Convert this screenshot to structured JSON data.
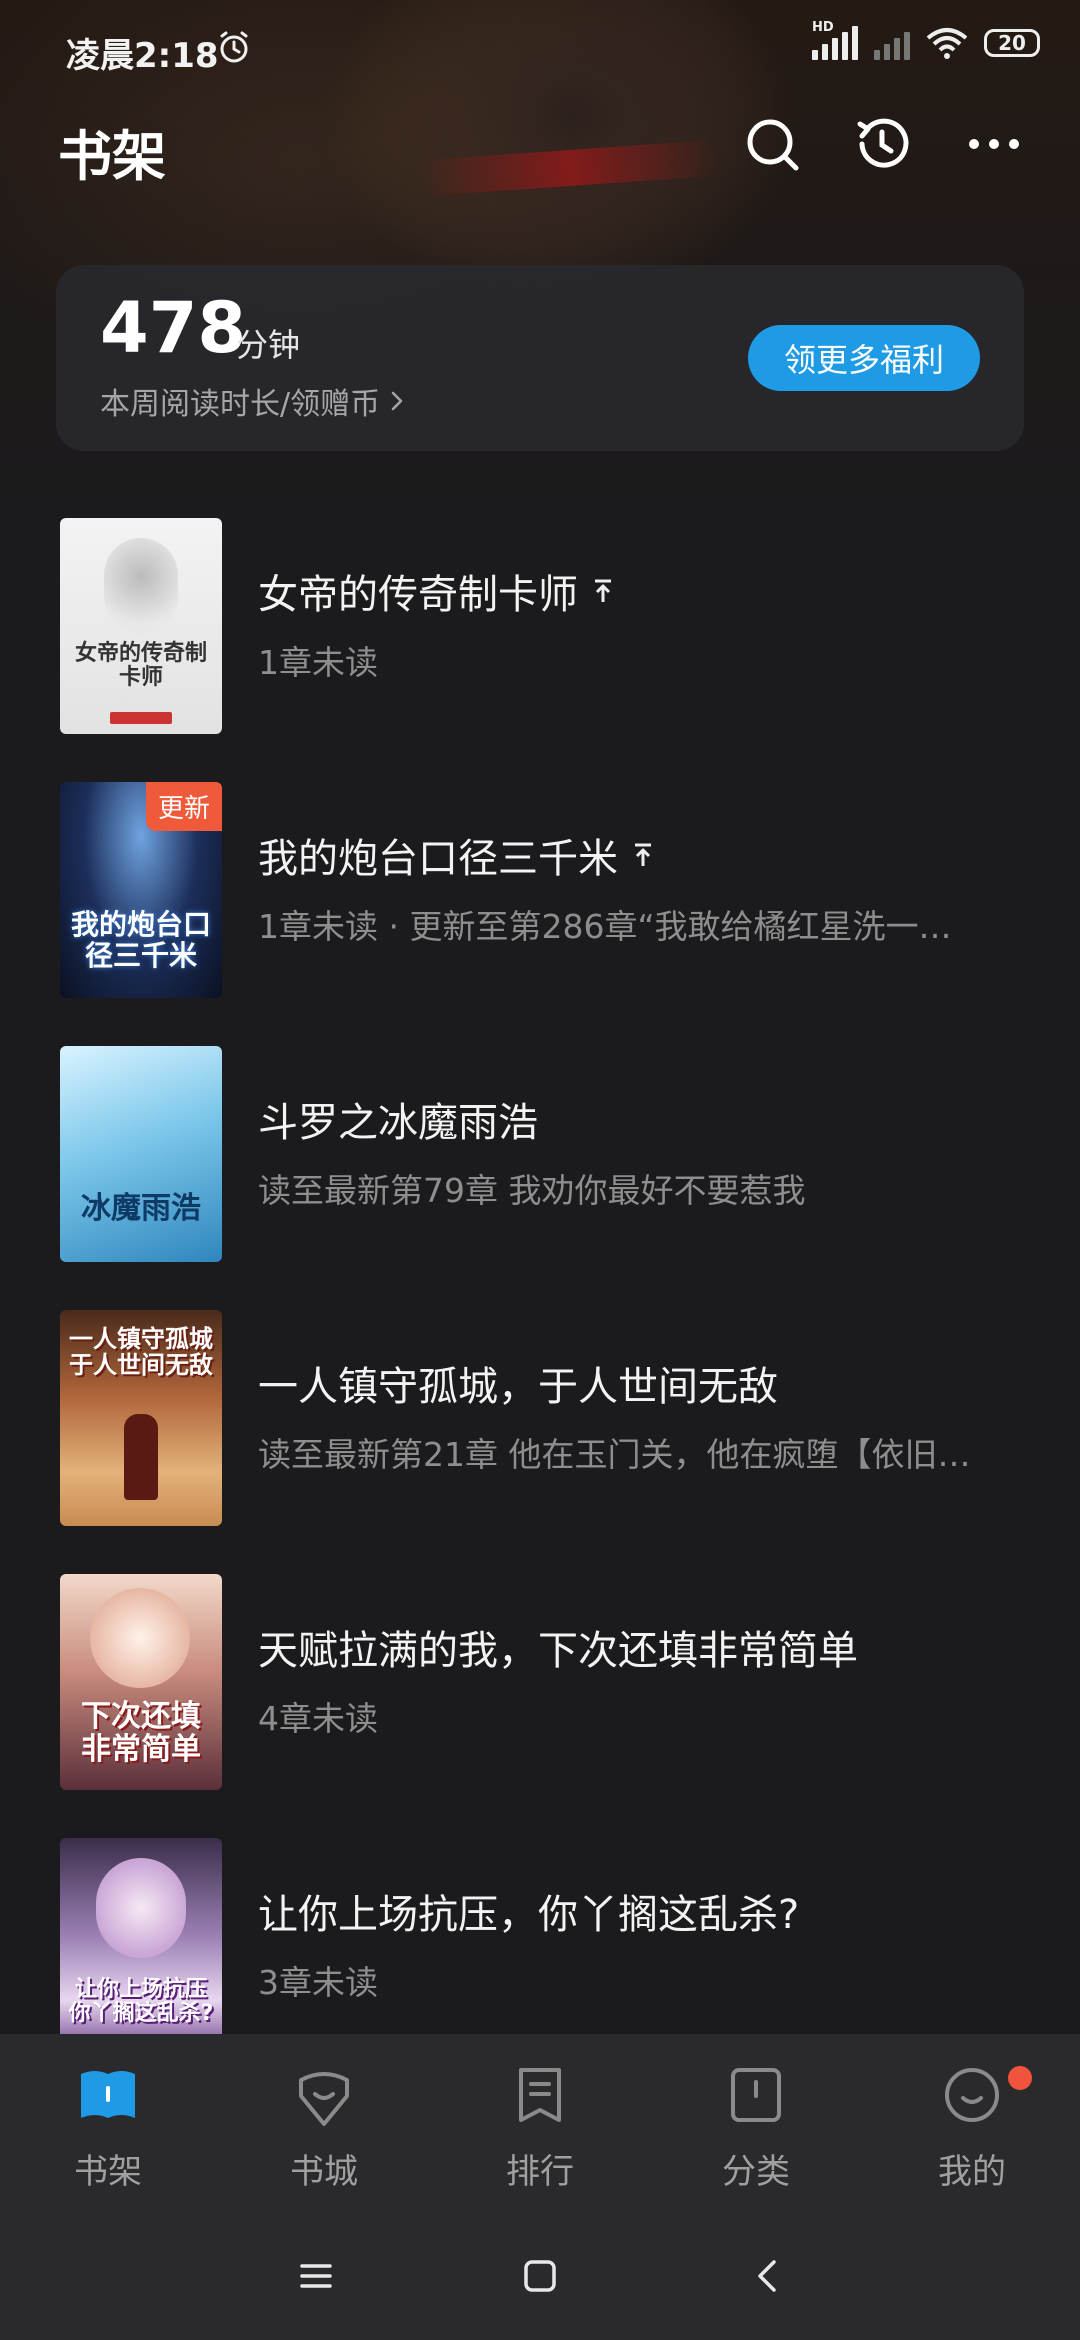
{
  "status_bar": {
    "time": "凌晨2:18",
    "network_badge": "HD",
    "battery": "20",
    "icons": [
      "alarm-icon",
      "signal-icon",
      "signal-off-icon",
      "wifi-icon",
      "battery-icon"
    ]
  },
  "header": {
    "title": "书架",
    "actions": [
      "search-icon",
      "history-icon",
      "more-icon"
    ]
  },
  "reading_card": {
    "minutes": "478",
    "unit": "分钟",
    "subtitle": "本周阅读时长/领赠币",
    "button": "领更多福利"
  },
  "books": [
    {
      "title": "女帝的传奇制卡师",
      "subtitle": "1章未读",
      "pinned": true,
      "badge": "",
      "cover_text": "女帝的传奇制卡师"
    },
    {
      "title": "我的炮台口径三千米",
      "subtitle": "1章未读 · 更新至第286章“我敢给橘红星洗一…",
      "pinned": true,
      "badge": "更新",
      "cover_text": "我的炮台口径三千米"
    },
    {
      "title": "斗罗之冰魔雨浩",
      "subtitle": "读至最新第79章 我劝你最好不要惹我",
      "pinned": false,
      "badge": "",
      "cover_text": "冰魔雨浩"
    },
    {
      "title": "一人镇守孤城，于人世间无敌",
      "subtitle": "读至最新第21章 他在玉门关，他在疯堕【依旧…",
      "pinned": false,
      "badge": "",
      "cover_text": "一人镇守孤城 于人世间无敌"
    },
    {
      "title": "天赋拉满的我，下次还填非常简单",
      "subtitle": "4章未读",
      "pinned": false,
      "badge": "",
      "cover_text": "下次还填 非常简单"
    },
    {
      "title": "让你上场抗压，你丫搁这乱杀?",
      "subtitle": "3章未读",
      "pinned": false,
      "badge": "",
      "cover_text": "让你上场抗压 你丫搁这乱杀?"
    }
  ],
  "bottom_nav": {
    "items": [
      {
        "label": "书架",
        "icon": "bookshelf-icon",
        "active": true
      },
      {
        "label": "书城",
        "icon": "bookstore-icon",
        "active": false
      },
      {
        "label": "排行",
        "icon": "ranking-icon",
        "active": false
      },
      {
        "label": "分类",
        "icon": "category-icon",
        "active": false
      },
      {
        "label": "我的",
        "icon": "profile-icon",
        "active": false
      }
    ]
  },
  "system_nav": [
    "menu-icon",
    "home-icon",
    "back-icon"
  ],
  "colors": {
    "accent": "#1f9be6",
    "badge": "#f0543c",
    "background": "#1b1b1d"
  }
}
